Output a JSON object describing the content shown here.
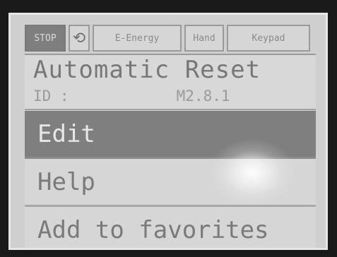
{
  "status_bar": {
    "stop": "STOP",
    "icon": "rotate-icon",
    "energy": "E-Energy",
    "hand": "Hand",
    "keypad": "Keypad"
  },
  "header": {
    "title": "Automatic Reset",
    "id_label": "ID :",
    "id_value": "M2.8.1"
  },
  "menu": {
    "items": [
      {
        "label": "Edit",
        "selected": true
      },
      {
        "label": "Help",
        "selected": false
      },
      {
        "label": "Add to favorites",
        "selected": false
      }
    ]
  }
}
